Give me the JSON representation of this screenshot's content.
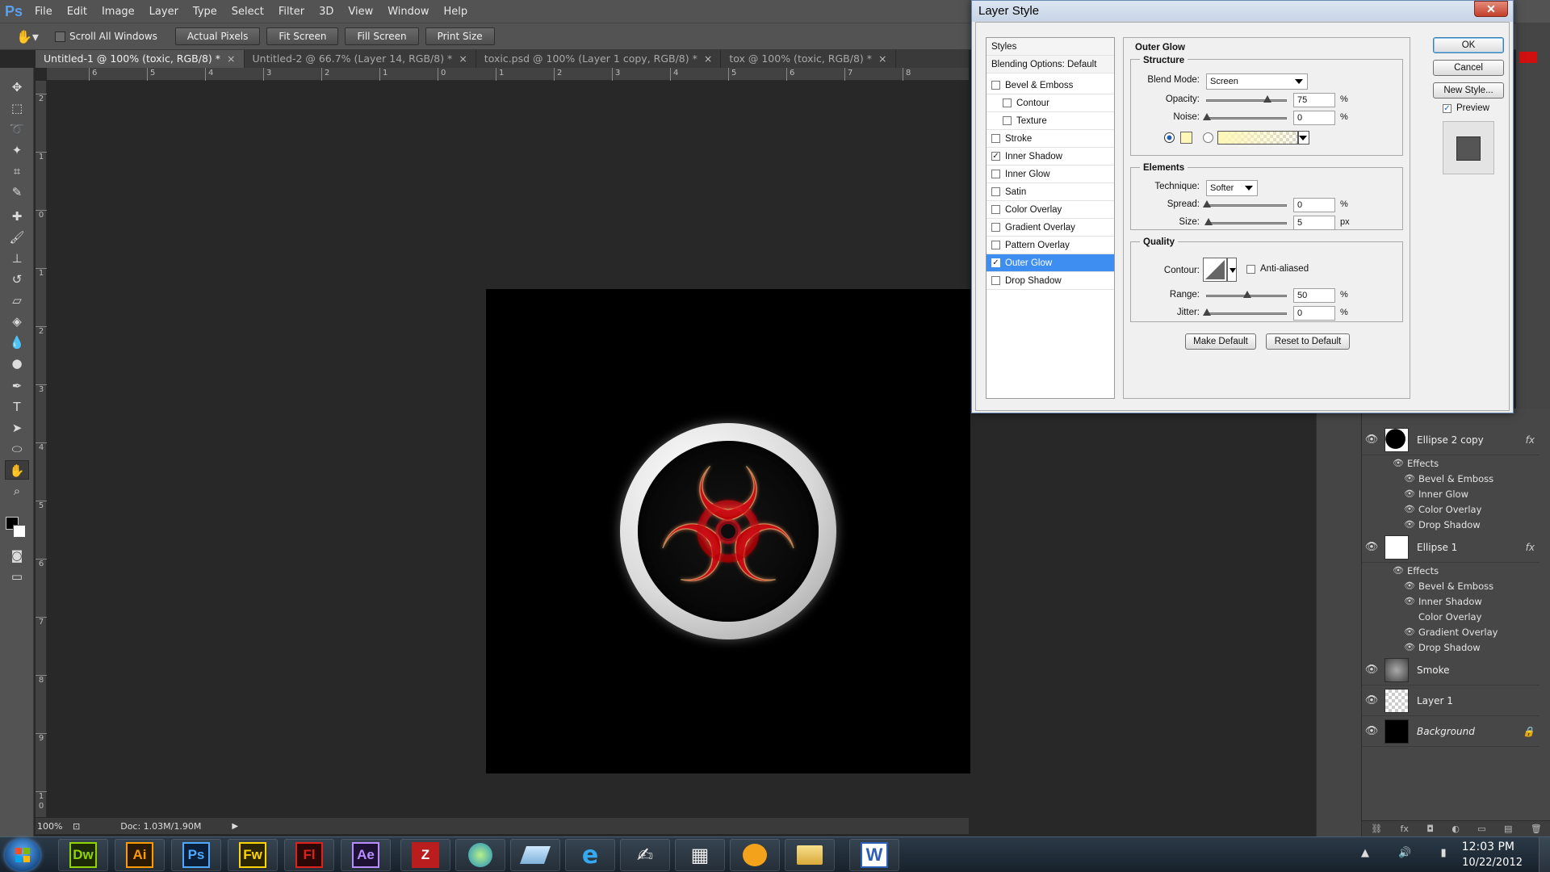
{
  "app": {
    "logo": "Ps",
    "menu": [
      "File",
      "Edit",
      "Image",
      "Layer",
      "Type",
      "Select",
      "Filter",
      "3D",
      "View",
      "Window",
      "Help"
    ]
  },
  "options_bar": {
    "scroll_all_windows": "Scroll All Windows",
    "buttons": [
      "Actual Pixels",
      "Fit Screen",
      "Fill Screen",
      "Print Size"
    ]
  },
  "tabs": [
    {
      "label": "Untitled-1 @ 100% (toxic, RGB/8) *",
      "active": true
    },
    {
      "label": "Untitled-2 @ 66.7% (Layer 14, RGB/8) *",
      "active": false
    },
    {
      "label": "toxic.psd @ 100% (Layer 1 copy, RGB/8) *",
      "active": false
    },
    {
      "label": "tox @ 100% (toxic, RGB/8) *",
      "active": false
    }
  ],
  "ruler_top": [
    "6",
    "5",
    "4",
    "3",
    "2",
    "1",
    "0",
    "1",
    "2",
    "3",
    "4",
    "5",
    "6",
    "7",
    "8"
  ],
  "ruler_left": [
    "2",
    "1",
    "0",
    "1",
    "2",
    "3",
    "4",
    "5",
    "6",
    "7",
    "8",
    "9",
    "1 0"
  ],
  "status_bar": {
    "zoom": "100%",
    "doc_size": "Doc: 1.03M/1.90M"
  },
  "layer_style_dialog": {
    "title": "Layer Style",
    "styles_list": {
      "header": "Styles",
      "blending_options": "Blending Options: Default",
      "items": [
        {
          "label": "Bevel & Emboss",
          "checked": false,
          "sub": false
        },
        {
          "label": "Contour",
          "checked": false,
          "sub": true
        },
        {
          "label": "Texture",
          "checked": false,
          "sub": true
        },
        {
          "label": "Stroke",
          "checked": false,
          "sub": false
        },
        {
          "label": "Inner Shadow",
          "checked": true,
          "sub": false
        },
        {
          "label": "Inner Glow",
          "checked": false,
          "sub": false
        },
        {
          "label": "Satin",
          "checked": false,
          "sub": false
        },
        {
          "label": "Color Overlay",
          "checked": false,
          "sub": false
        },
        {
          "label": "Gradient Overlay",
          "checked": false,
          "sub": false
        },
        {
          "label": "Pattern Overlay",
          "checked": false,
          "sub": false
        },
        {
          "label": "Outer Glow",
          "checked": true,
          "sub": false,
          "selected": true
        },
        {
          "label": "Drop Shadow",
          "checked": false,
          "sub": false
        }
      ]
    },
    "outer_glow": {
      "section_title": "Outer Glow",
      "structure": {
        "title": "Structure",
        "blend_mode_label": "Blend Mode:",
        "blend_mode": "Screen",
        "opacity_label": "Opacity:",
        "opacity": "75",
        "opacity_value": 75,
        "noise_label": "Noise:",
        "noise": "0",
        "noise_value": 0,
        "glow_color": "#fff7b8",
        "percent": "%"
      },
      "elements": {
        "title": "Elements",
        "technique_label": "Technique:",
        "technique": "Softer",
        "spread_label": "Spread:",
        "spread": "0",
        "spread_value": 0,
        "size_label": "Size:",
        "size": "5",
        "size_value": 5,
        "size_unit": "px",
        "percent": "%"
      },
      "quality": {
        "title": "Quality",
        "contour_label": "Contour:",
        "anti_aliased": "Anti-aliased",
        "range_label": "Range:",
        "range": "50",
        "range_value": 50,
        "jitter_label": "Jitter:",
        "jitter": "0",
        "jitter_value": 0,
        "percent": "%"
      },
      "make_default": "Make Default",
      "reset_to_default": "Reset to Default"
    },
    "buttons": {
      "ok": "OK",
      "cancel": "Cancel",
      "new_style": "New Style...",
      "preview": "Preview"
    }
  },
  "layers": [
    {
      "name": "Ellipse 2 copy",
      "fx": "fx",
      "effects_label": "Effects",
      "effects": [
        {
          "label": "Bevel & Emboss",
          "visible": true
        },
        {
          "label": "Inner Glow",
          "visible": true
        },
        {
          "label": "Color Overlay",
          "visible": true
        },
        {
          "label": "Drop Shadow",
          "visible": true
        }
      ]
    },
    {
      "name": "Ellipse 1",
      "fx": "fx",
      "effects_label": "Effects",
      "effects": [
        {
          "label": "Bevel & Emboss",
          "visible": true
        },
        {
          "label": "Inner Shadow",
          "visible": true
        },
        {
          "label": "Color Overlay",
          "visible": false
        },
        {
          "label": "Gradient Overlay",
          "visible": true
        },
        {
          "label": "Drop Shadow",
          "visible": true
        }
      ]
    },
    {
      "name": "Smoke"
    },
    {
      "name": "Layer 1"
    },
    {
      "name": "Background",
      "locked": true
    }
  ],
  "taskbar": {
    "apps": [
      {
        "label": "Dw",
        "color": "#8fd400",
        "bg": "#1c2a08"
      },
      {
        "label": "Ai",
        "color": "#ff9a00",
        "bg": "#2a1a05"
      },
      {
        "label": "Ps",
        "color": "#4fa8ff",
        "bg": "#0b1f38"
      },
      {
        "label": "Fw",
        "color": "#ffd400",
        "bg": "#2a2605"
      },
      {
        "label": "Fl",
        "color": "#e0201a",
        "bg": "#2a0807"
      },
      {
        "label": "Ae",
        "color": "#b98cff",
        "bg": "#1d1233"
      }
    ],
    "time": "12:03 PM",
    "date": "10/22/2012"
  },
  "colors": {
    "hazard_red": "#e8141a",
    "selection_blue": "#3d8ef0"
  }
}
